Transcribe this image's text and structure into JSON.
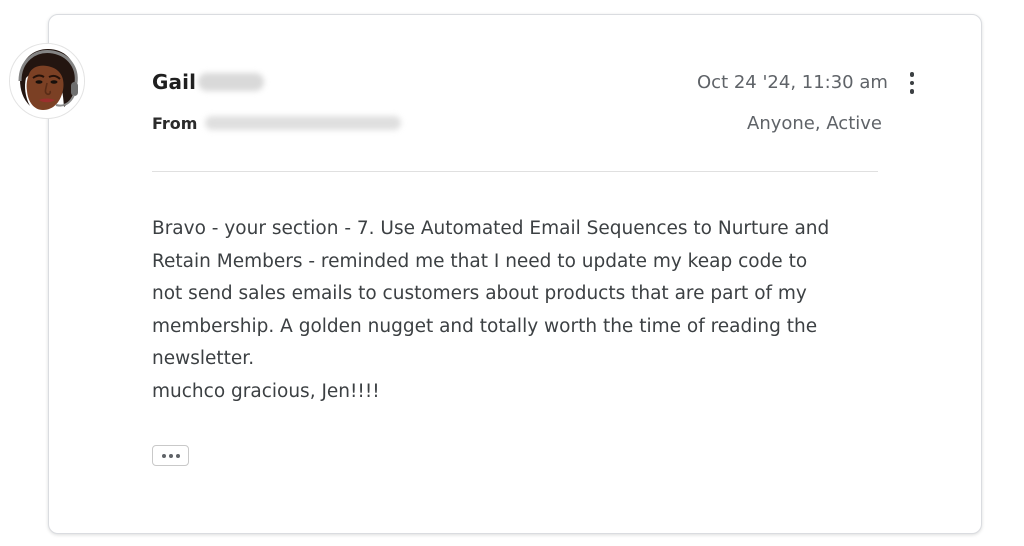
{
  "message": {
    "sender_name": "Gail",
    "from_label": "From",
    "timestamp": "Oct 24 '24, 11:30 am",
    "visibility": "Anyone, Active",
    "body_paragraphs": [
      "Bravo - your section - 7. Use Automated Email Sequences to Nurture and Retain Members - reminded me that I need to update my keap code to not send sales emails to customers about products that are part of my membership. A golden nugget and totally worth the time of reading the newsletter.",
      "muchco gracious, Jen!!!!"
    ]
  },
  "icons": {
    "avatar": "avatar-portrait",
    "menu": "more-vertical-icon",
    "expand": "more-horizontal-icon"
  },
  "colors": {
    "text_primary": "#202124",
    "text_secondary": "#5f6368",
    "border": "#dadce0"
  }
}
